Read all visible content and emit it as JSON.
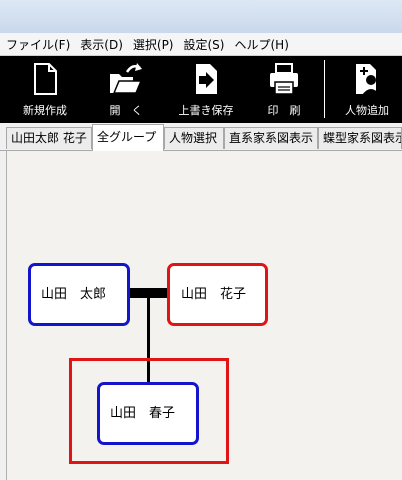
{
  "menu": [
    {
      "label": "ファイル(F)"
    },
    {
      "label": "表示(D)"
    },
    {
      "label": "選択(P)"
    },
    {
      "label": "設定(S)"
    },
    {
      "label": "ヘルプ(H)"
    }
  ],
  "toolbar": {
    "new": "新規作成",
    "open": "開　く",
    "save": "上書き保存",
    "print": "印　刷",
    "add_person": "人物追加"
  },
  "tabs": [
    "山田太郎 花子",
    "全グループ",
    "人物選択",
    "直系家系図表示",
    "蝶型家系図表示"
  ],
  "tree": {
    "father": "山田　太郎",
    "mother": "山田　花子",
    "child": "山田　春子"
  },
  "colors": {
    "male": "#1414cc",
    "female": "#e01414",
    "toolbar_bg": "#000000"
  }
}
